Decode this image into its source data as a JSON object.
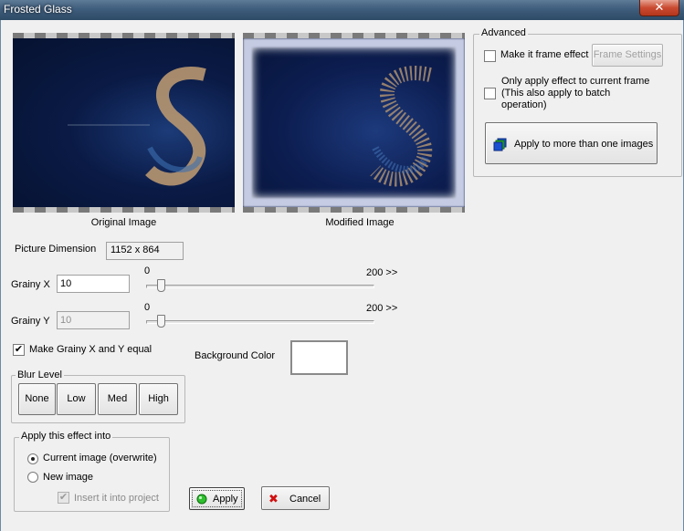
{
  "window": {
    "title": "Frosted Glass",
    "close_label": "✕"
  },
  "preview": {
    "original_caption": "Original Image",
    "modified_caption": "Modified Image"
  },
  "picture_dimension": {
    "label": "Picture Dimension",
    "value": "1152 x 864"
  },
  "grainy_x": {
    "label": "Grainy X",
    "value": "10",
    "min_label": "0",
    "max_label": "200 >>",
    "level": 10
  },
  "grainy_y": {
    "label": "Grainy Y",
    "value": "10",
    "min_label": "0",
    "max_label": "200 >>",
    "level": 10
  },
  "make_equal": {
    "label": "Make Grainy X and Y equal",
    "checked": true
  },
  "background_color": {
    "label": "Background Color",
    "color": "#ffffff"
  },
  "blur_level": {
    "legend": "Blur Level",
    "options": [
      "None",
      "Low",
      "Med",
      "High"
    ]
  },
  "apply_into": {
    "legend": "Apply this effect into",
    "current": "Current image (overwrite)",
    "new": "New image",
    "insert": "Insert it into project"
  },
  "actions": {
    "apply": "Apply",
    "cancel": "Cancel"
  },
  "advanced": {
    "legend": "Advanced",
    "frame_effect": "Make it frame effect",
    "frame_settings": "Frame Settings",
    "only_current": "Only apply effect to current frame (This also apply to batch operation)",
    "apply_more": "Apply to more than one images"
  }
}
